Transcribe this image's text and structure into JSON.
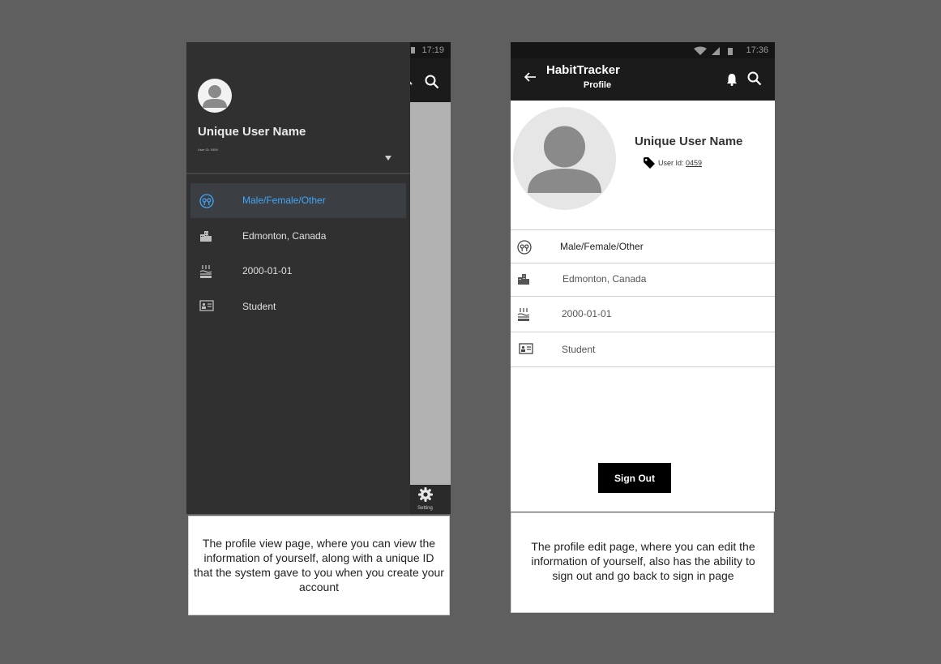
{
  "left_screen": {
    "status_time": "17:19",
    "drawer": {
      "username": "Unique User Name",
      "user_id": "User ID: 0459",
      "items": [
        {
          "icon": "gender-icon",
          "label": "Male/Female/Other",
          "selected": true
        },
        {
          "icon": "city-icon",
          "label": "Edmonton, Canada"
        },
        {
          "icon": "cake-icon",
          "label": "2000-01-01"
        },
        {
          "icon": "id-card-icon",
          "label": "Student"
        }
      ]
    },
    "setting_label": "Setting",
    "caption": "The profile view page, where you can view the information of yourself, along with a unique ID that the system gave to you when you create your account"
  },
  "right_screen": {
    "status_time": "17:36",
    "app_title": "HabitTracker",
    "app_subtitle": "Profile",
    "username": "Unique User Name",
    "user_id_label": "User Id:",
    "user_id_value": "0459",
    "rows": [
      {
        "icon": "gender-icon",
        "label": "Male/Female/Other"
      },
      {
        "icon": "city-icon",
        "label": "Edmonton, Canada"
      },
      {
        "icon": "cake-icon",
        "label": "2000-01-01"
      },
      {
        "icon": "id-card-icon",
        "label": "Student"
      }
    ],
    "signout_label": "Sign Out",
    "caption": "The profile edit page, where you can edit the information of yourself, also has the ability to sign out and go back to sign in page"
  },
  "colors": {
    "background": "#5f5f5f",
    "drawer": "#303030",
    "appbar": "#1b1b1b",
    "selected_accent": "#42a5f5"
  }
}
